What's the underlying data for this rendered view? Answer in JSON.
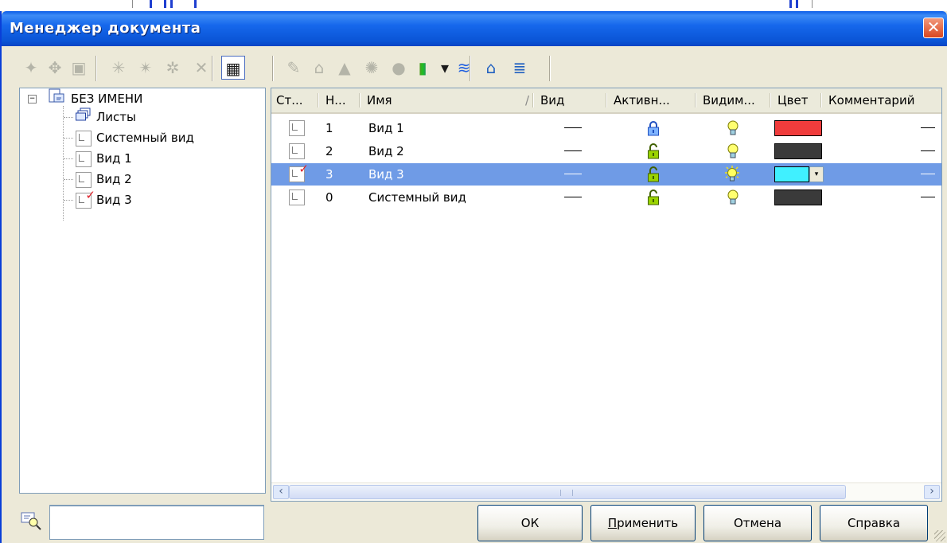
{
  "window": {
    "title": "Менеджер документа",
    "close_glyph": "✕"
  },
  "toolbar": {
    "buttons": [
      {
        "icon": "new-sheet-icon",
        "glyph": "✦",
        "enabled": false
      },
      {
        "icon": "sheet-numbering-icon",
        "glyph": "✥",
        "enabled": false
      },
      {
        "icon": "sheet-format-icon",
        "glyph": "▣",
        "enabled": false
      },
      {
        "icon": "new-view-icon",
        "glyph": "✳",
        "enabled": false
      },
      {
        "icon": "new-view-plus-icon",
        "glyph": "✴",
        "enabled": false
      },
      {
        "icon": "view-arrow-icon",
        "glyph": "✲",
        "enabled": false
      },
      {
        "icon": "delete-icon",
        "glyph": "✕",
        "enabled": false
      },
      {
        "icon": "list-view-icon",
        "glyph": "▦",
        "enabled": true
      },
      {
        "icon": "edit-icon",
        "glyph": "✎",
        "enabled": false
      },
      {
        "icon": "unlock-icon",
        "glyph": "⌂",
        "enabled": false
      },
      {
        "icon": "lock-icon",
        "glyph": "▲",
        "enabled": false
      },
      {
        "icon": "light-on-icon",
        "glyph": "✺",
        "enabled": false
      },
      {
        "icon": "light-off-icon",
        "glyph": "●",
        "enabled": false
      },
      {
        "icon": "color-icon",
        "glyph": "▮",
        "enabled": true
      },
      {
        "icon": "dropdown-icon",
        "glyph": "▾",
        "enabled": true
      },
      {
        "icon": "layers-check-icon",
        "glyph": "≋",
        "enabled": true
      },
      {
        "icon": "import-view-icon",
        "glyph": "⌂",
        "enabled": true
      },
      {
        "icon": "layers-icon",
        "glyph": "≣",
        "enabled": true
      }
    ]
  },
  "tree": {
    "root": "БЕЗ ИМЕНИ",
    "expander": "−",
    "items": [
      {
        "label": "Листы",
        "icon": "sheets-icon"
      },
      {
        "label": "Системный вид",
        "icon": "view-icon"
      },
      {
        "label": "Вид 1",
        "icon": "view-icon"
      },
      {
        "label": "Вид 2",
        "icon": "view-icon"
      },
      {
        "label": "Вид 3",
        "icon": "current-view-icon"
      }
    ]
  },
  "list": {
    "columns": [
      "Ст...",
      "Н...",
      "Имя",
      "/",
      "Вид",
      "Активн...",
      "Видим...",
      "Цвет",
      "Комментарий"
    ],
    "rows": [
      {
        "number": "1",
        "name": "Вид 1",
        "locked": true,
        "bright": false,
        "color": "#f03c3c",
        "current": false,
        "selected": false,
        "view": "—",
        "comment": "—"
      },
      {
        "number": "2",
        "name": "Вид 2",
        "locked": false,
        "bright": false,
        "color": "#3a3a3a",
        "current": false,
        "selected": false,
        "view": "—",
        "comment": "—"
      },
      {
        "number": "3",
        "name": "Вид 3",
        "locked": false,
        "bright": true,
        "color": "#40f0ff",
        "current": true,
        "selected": true,
        "view": "—",
        "comment": "—"
      },
      {
        "number": "0",
        "name": "Системный вид",
        "locked": false,
        "bright": false,
        "color": "#3a3a3a",
        "current": false,
        "selected": false,
        "view": "—",
        "comment": "—"
      }
    ],
    "scroll_left": "‹",
    "scroll_right": "›",
    "dropdown_glyph": "▾"
  },
  "search": {
    "placeholder": ""
  },
  "buttons": {
    "ok": "ОК",
    "apply": "Применить",
    "cancel": "Отмена",
    "help": "Справка"
  },
  "colors": {
    "title_blue": "#0a5ce8",
    "selection": "#6f9be6",
    "dialog": "#ece9d8"
  }
}
